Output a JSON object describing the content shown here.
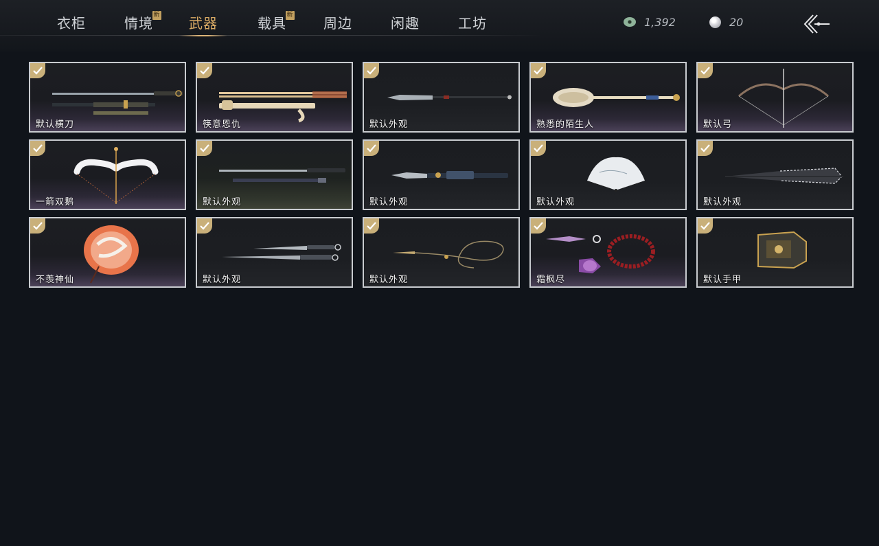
{
  "tabs": [
    {
      "label": "衣柜",
      "active": false,
      "new": false
    },
    {
      "label": "情境",
      "active": false,
      "new": true
    },
    {
      "label": "武器",
      "active": true,
      "new": false
    },
    {
      "label": "载具",
      "active": false,
      "new": true
    },
    {
      "label": "周边",
      "active": false,
      "new": false
    },
    {
      "label": "闲趣",
      "active": false,
      "new": false
    },
    {
      "label": "工坊",
      "active": false,
      "new": false
    }
  ],
  "new_badge_text": "新",
  "currency": {
    "coins": "1,392",
    "pearls": "20"
  },
  "icons": {
    "coin": "jade-coin-icon",
    "pearl": "pearl-icon",
    "back": "back-arrow-icon",
    "owned": "checkmark-icon"
  },
  "colors": {
    "accent": "#d7a964",
    "check": "#c9b07a",
    "background": "#10141a"
  },
  "items": [
    {
      "label": "默认横刀",
      "owned": true,
      "art": "blade-icon"
    },
    {
      "label": "筷意恩仇",
      "owned": true,
      "art": "chopsticks-icon"
    },
    {
      "label": "默认外观",
      "owned": true,
      "art": "spear-icon"
    },
    {
      "label": "熟悉的陌生人",
      "owned": true,
      "art": "ladle-icon"
    },
    {
      "label": "默认弓",
      "owned": true,
      "art": "bow-icon"
    },
    {
      "label": "一箭双鹅",
      "owned": true,
      "art": "goose-bow-icon"
    },
    {
      "label": "默认外观",
      "owned": true,
      "art": "twin-swords-icon"
    },
    {
      "label": "默认外观",
      "owned": true,
      "art": "glaive-icon"
    },
    {
      "label": "默认外观",
      "owned": true,
      "art": "fan-icon"
    },
    {
      "label": "默认外观",
      "owned": true,
      "art": "umbrella-icon"
    },
    {
      "label": "不羡神仙",
      "owned": true,
      "art": "parasol-icon"
    },
    {
      "label": "默认外观",
      "owned": true,
      "art": "dual-daggers-icon"
    },
    {
      "label": "默认外观",
      "owned": true,
      "art": "rope-dart-icon"
    },
    {
      "label": "霜枫尽",
      "owned": true,
      "art": "prayer-beads-icon"
    },
    {
      "label": "默认手甲",
      "owned": true,
      "art": "gauntlet-icon"
    }
  ]
}
